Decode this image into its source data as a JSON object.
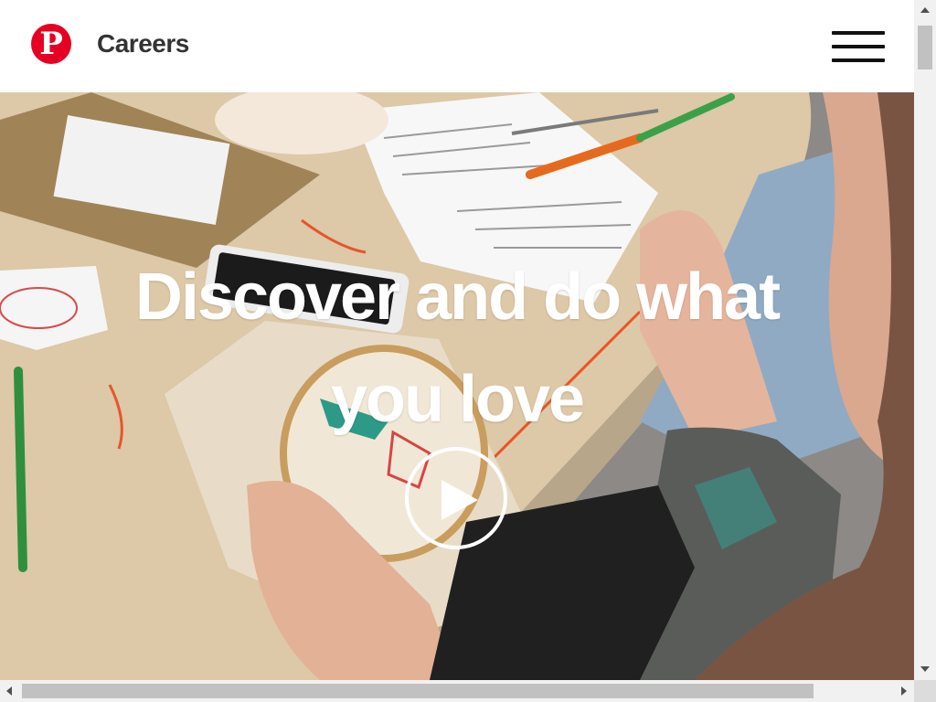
{
  "header": {
    "logo_letter": "P",
    "brand_text": "Careers"
  },
  "hero": {
    "headline": "Discover and do what you love",
    "play_label": "Play video"
  },
  "colors": {
    "brand_red": "#e60023",
    "header_text": "#333333"
  },
  "icons": {
    "logo": "pinterest-logo-icon",
    "menu": "hamburger-menu-icon",
    "play": "play-icon"
  }
}
